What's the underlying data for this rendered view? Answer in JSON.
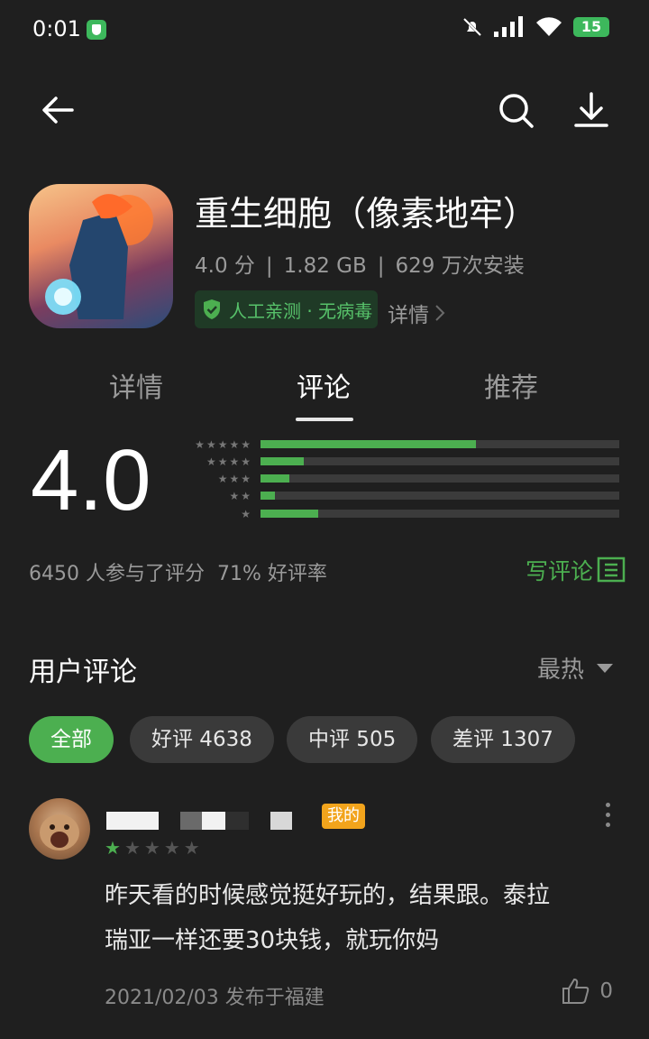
{
  "status_bar": {
    "time": "0:01",
    "battery": "15"
  },
  "app": {
    "title": "重生细胞（像素地牢）",
    "score": "4.0 分",
    "size": "1.82 GB",
    "installs": "629 万次安装",
    "safe_label": "人工亲测 · 无病毒",
    "detail_link": "详情"
  },
  "tabs": [
    {
      "label": "详情"
    },
    {
      "label": "评论"
    },
    {
      "label": "推荐"
    }
  ],
  "rating": {
    "value": "4.0",
    "distribution": [
      {
        "stars": 5,
        "fraction": 0.6
      },
      {
        "stars": 4,
        "fraction": 0.12
      },
      {
        "stars": 3,
        "fraction": 0.08
      },
      {
        "stars": 2,
        "fraction": 0.04
      },
      {
        "stars": 1,
        "fraction": 0.16
      }
    ],
    "participants": "6450 人参与了评分",
    "positive_rate": "71% 好评率",
    "write_review": "写评论"
  },
  "reviews_section": {
    "title": "用户评论",
    "sort": "最热",
    "filters": [
      {
        "label": "全部"
      },
      {
        "label": "好评 4638"
      },
      {
        "label": "中评 505"
      },
      {
        "label": "差评 1307"
      }
    ]
  },
  "review": {
    "badge": "我的",
    "stars": 1,
    "text_line1": "昨天看的时候感觉挺好玩的，结果跟。泰拉",
    "text_line2": "瑞亚一样还要30块钱，就玩你妈",
    "date": "2021/02/03 发布于福建",
    "likes": "0"
  }
}
